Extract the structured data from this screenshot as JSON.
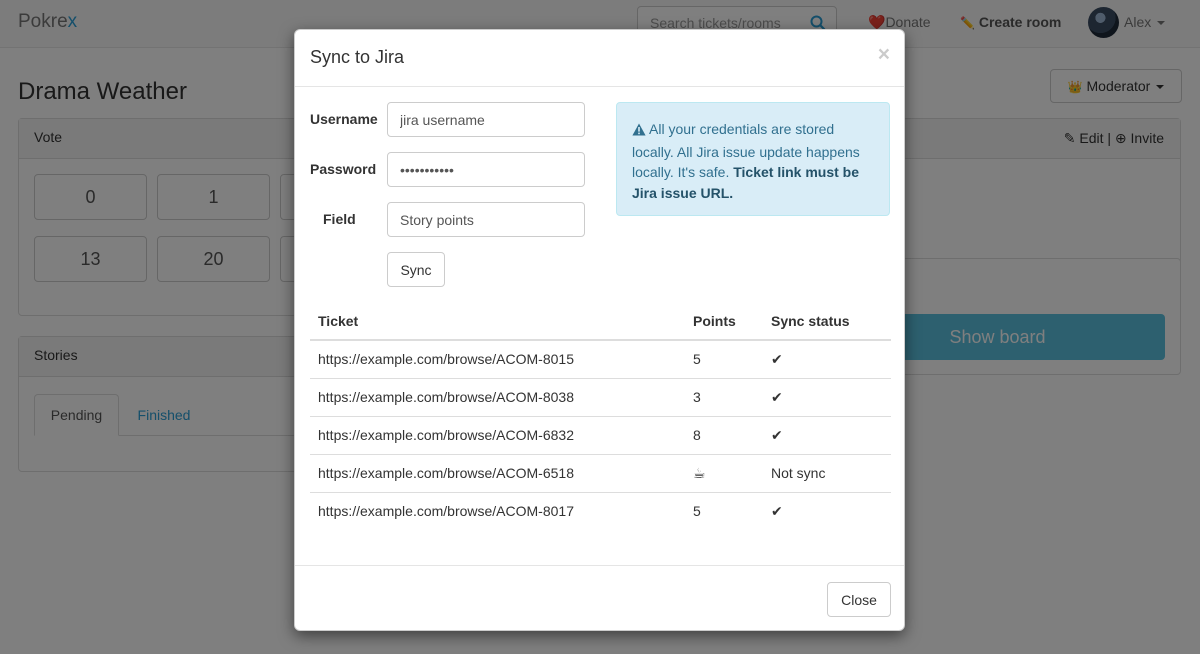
{
  "navbar": {
    "brand_main": "Pokre",
    "brand_accent": "x",
    "search_placeholder": "Search tickets/rooms",
    "donate_icon": "❤️",
    "donate_label": "Donate",
    "create_icon": "✏️",
    "create_label": "Create room",
    "user_name": "Alex"
  },
  "room": {
    "title": "Drama Weather",
    "role_icon": "👑",
    "role_label": "Moderator",
    "vote_panel_title": "Vote",
    "edit_label": "Edit",
    "invite_label": "Invite",
    "cards": [
      "0",
      "1",
      "13",
      "20"
    ],
    "show_board_label": "Show board",
    "stories_panel_title": "Stories",
    "tab_pending": "Pending",
    "tab_finished": "Finished"
  },
  "modal": {
    "title": "Sync to Jira",
    "close_x": "×",
    "username_label": "Username",
    "username_placeholder": "jira username",
    "password_label": "Password",
    "password_value": "secretpassw",
    "field_label": "Field",
    "field_value": "Story points",
    "sync_button": "Sync",
    "info_text": "All your credentials are stored locally. All Jira issue update happens locally. It's safe.",
    "info_bold": "Ticket link must be Jira issue URL.",
    "table_headers": [
      "Ticket",
      "Points",
      "Sync status"
    ],
    "rows": [
      {
        "ticket": "https://example.com/browse/ACOM-8015",
        "points": "5",
        "status": "✔"
      },
      {
        "ticket": "https://example.com/browse/ACOM-8038",
        "points": "3",
        "status": "✔"
      },
      {
        "ticket": "https://example.com/browse/ACOM-6832",
        "points": "8",
        "status": "✔"
      },
      {
        "ticket": "https://example.com/browse/ACOM-6518",
        "points": "☕",
        "status": "Not sync"
      },
      {
        "ticket": "https://example.com/browse/ACOM-8017",
        "points": "5",
        "status": "✔"
      }
    ],
    "close_button": "Close"
  },
  "colors": {
    "brand_accent": "#2a9fd6",
    "show_board": "#5bc0de",
    "alert_bg": "#d9edf7",
    "alert_text": "#31708f"
  }
}
